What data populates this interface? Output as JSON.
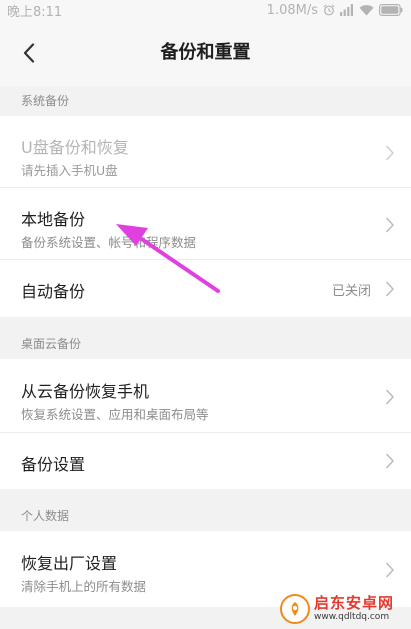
{
  "status_bar": {
    "time": "晚上8:11",
    "speed": "1.08M/s"
  },
  "header": {
    "title": "备份和重置"
  },
  "sections": {
    "system": {
      "label": "系统备份",
      "usb": {
        "title": "U盘备份和恢复",
        "subtitle": "请先插入手机U盘"
      },
      "local": {
        "title": "本地备份",
        "subtitle": "备份系统设置、帐号和程序数据"
      },
      "auto": {
        "title": "自动备份",
        "value": "已关闭"
      }
    },
    "cloud": {
      "label": "桌面云备份",
      "restore": {
        "title": "从云备份恢复手机",
        "subtitle": "恢复系统设置、应用和桌面布局等"
      },
      "settings": {
        "title": "备份设置"
      }
    },
    "personal": {
      "label": "个人数据",
      "factory_reset": {
        "title": "恢复出厂设置",
        "subtitle": "清除手机上的所有数据"
      }
    }
  },
  "annotation": {
    "arrow_color": "#e040e0"
  },
  "watermark": {
    "name": "启东安卓网",
    "url": "www.qdltdq.com"
  },
  "colors": {
    "background": "#f2f2f2",
    "card": "#ffffff",
    "primary_text": "#1f1f1f",
    "secondary_text": "#8c8c8c",
    "disabled_text": "#b5b5b5"
  },
  "icons": {
    "back": "chevron-left-icon",
    "row": "chevron-right-icon",
    "status": [
      "alarm-icon",
      "signal-icon",
      "wifi-icon",
      "battery-icon"
    ]
  }
}
